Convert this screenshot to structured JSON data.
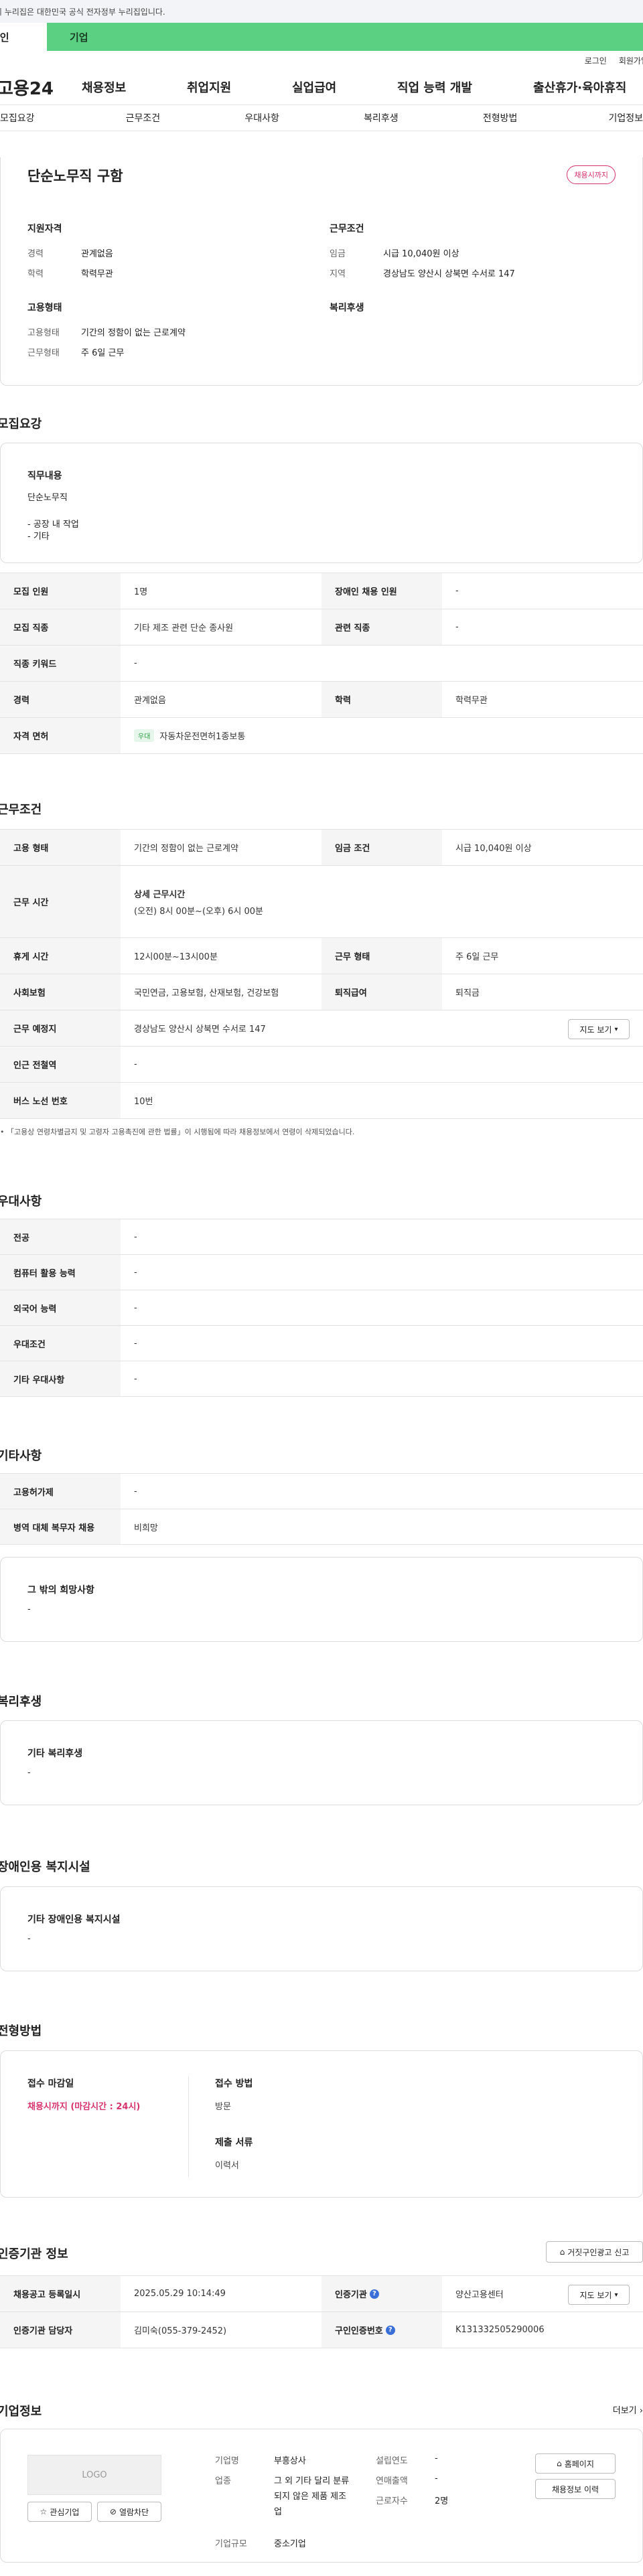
{
  "gov_notice": "이 누리집은 대한민국 공식 전자정부 누리집입니다.",
  "tabs": {
    "individual": "개인",
    "business": "기업"
  },
  "util": {
    "login": "로그인",
    "join": "회원가입"
  },
  "logo": "고용24",
  "gnb": [
    "채용정보",
    "취업지원",
    "실업급여",
    "직업 능력 개발",
    "출산휴가·육아휴직"
  ],
  "sub_tabs": [
    "모집요강",
    "근무조건",
    "우대사항",
    "복리후생",
    "전형방법",
    "기업정보"
  ],
  "summary": {
    "title": "단순노무직 구함",
    "badge": "채용시까지",
    "qual_title": "지원자격",
    "career_label": "경력",
    "career_value": "관계없음",
    "edu_label": "학력",
    "edu_value": "학력무관",
    "cond_title": "근무조건",
    "wage_label": "임금",
    "wage_value": "시급 10,040원 이상",
    "region_label": "지역",
    "region_value": "경상남도 양산시 상북면 수서로 147",
    "emp_title": "고용형태",
    "emp_type_label": "고용형태",
    "emp_type_value": "기간의 정함이 없는 근로계약",
    "work_form_label": "근무형태",
    "work_form_value": "주 6일 근무",
    "welfare_title": "복리후생"
  },
  "recruit": {
    "section_title": "모집요강",
    "duty_title": "직무내용",
    "duty_lines": [
      "단순노무직",
      "",
      "- 공장 내 작업",
      "- 기타"
    ],
    "rows": [
      {
        "l1": "모집 인원",
        "v1": "1명",
        "l2": "장애인 채용 인원",
        "v2": "-"
      },
      {
        "l1": "모집 직종",
        "v1": "기타 제조 관련 단순 종사원",
        "l2": "관련 직종",
        "v2": "-"
      },
      {
        "l1": "직종 키워드",
        "v1": "-",
        "l2": "",
        "v2": ""
      },
      {
        "l1": "경력",
        "v1": "관계없음",
        "l2": "학력",
        "v2": "학력무관"
      },
      {
        "l1": "자격 면허",
        "v1": "자동차운전면허1종보통",
        "badge": "우대",
        "l2": "",
        "v2": ""
      }
    ]
  },
  "work": {
    "section_title": "근무조건",
    "emp_label": "고용 형태",
    "emp_value": "기간의 정함이 없는 근로계약",
    "wage_label": "임금 조건",
    "wage_value": "시급 10,040원 이상",
    "time_label": "근무 시간",
    "time_title": "상세 근무시간",
    "time_value": "(오전) 8시 00분~(오후) 6시 00분",
    "break_label": "휴게 시간",
    "break_value": "12시00분~13시00분",
    "form_label": "근무 형태",
    "form_value": "주 6일 근무",
    "ins_label": "사회보험",
    "ins_value": "국민연금, 고용보험, 산재보험, 건강보험",
    "sev_label": "퇴직급여",
    "sev_value": "퇴직금",
    "place_label": "근무 예정지",
    "place_value": "경상남도 양산시 상북면 수서로 147",
    "map_btn": "지도 보기",
    "subway_label": "인근 전철역",
    "subway_value": "-",
    "bus_label": "버스 노선 번호",
    "bus_value": "10번",
    "notice": "「고용상 연령차별금지 및 고령자 고용촉진에 관한 법률」이 시행됨에 따라 채용정보에서 연령이 삭제되었습니다."
  },
  "pref": {
    "section_title": "우대사항",
    "rows": [
      {
        "label": "전공",
        "value": "-"
      },
      {
        "label": "컴퓨터 활용 능력",
        "value": "-"
      },
      {
        "label": "외국어 능력",
        "value": "-"
      },
      {
        "label": "우대조건",
        "value": "-"
      },
      {
        "label": "기타 우대사항",
        "value": "-"
      }
    ]
  },
  "etc": {
    "section_title": "기타사항",
    "rows": [
      {
        "label": "고용허가제",
        "value": "-"
      },
      {
        "label": "병역 대체 복무자 채용",
        "value": "비희망"
      }
    ],
    "wish_title": "그 밖의 희망사항",
    "wish_value": "-"
  },
  "welfare": {
    "section_title": "복리후생",
    "card_title": "기타 복리후생",
    "card_value": "-"
  },
  "disab": {
    "section_title": "장애인용 복지시설",
    "card_title": "기타 장애인용 복지시설",
    "card_value": "-"
  },
  "selection": {
    "section_title": "전형방법",
    "deadline_title": "접수 마감일",
    "deadline_value": "채용시까지 (마감시간 : 24시)",
    "method_title": "접수 방법",
    "method_value": "방문",
    "docs_title": "제출 서류",
    "docs_value": "이력서"
  },
  "cert": {
    "section_title": "인증기관 정보",
    "report_btn": "거짓구인광고 신고",
    "reg_label": "채용공고 등록일시",
    "reg_value": "2025.05.29 10:14:49",
    "org_label": "인증기관",
    "org_value": "양산고용센터",
    "map_btn": "지도 보기",
    "manager_label": "인증기관 담당자",
    "manager_value": "김미숙(055-379-2452)",
    "auth_label": "구인인증번호",
    "auth_value": "K131332505290006"
  },
  "company": {
    "section_title": "기업정보",
    "more": "더보기",
    "logo_text": "LOGO",
    "interest_btn": "관심기업",
    "block_btn": "열람차단",
    "name_label": "기업명",
    "name_value": "부흥상사",
    "industry_label": "업종",
    "industry_value": "그 외 기타 달리 분류되지 않은 제품 제조업",
    "size_label": "기업규모",
    "size_value": "중소기업",
    "founded_label": "설립연도",
    "founded_value": "-",
    "sales_label": "연매출액",
    "sales_value": "-",
    "staff_label": "근로자수",
    "staff_value": "2명",
    "homepage_btn": "홈페이지",
    "history_btn": "채용정보 이력"
  }
}
